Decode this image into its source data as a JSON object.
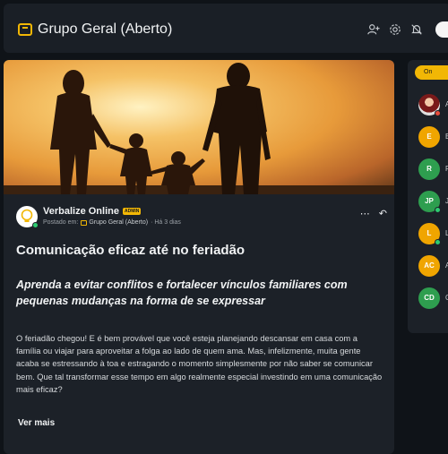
{
  "header": {
    "title": "Grupo Geral (Aberto)",
    "icons": [
      "add-member-icon",
      "settings-icon",
      "notifications-off-icon"
    ]
  },
  "post": {
    "author": {
      "name": "Verbalize Online",
      "badge": "ADMIN",
      "posted_in_label": "Postado em:",
      "group_link": "Grupo Geral (Aberto)",
      "time": "· Há 3 dias"
    },
    "title": "Comunicação eficaz até no feriadão",
    "subtitle": "Aprenda a evitar conflitos e fortalecer vínculos familiares com pequenas mudanças na forma de se expressar",
    "body": "O feriadão chegou! E é bem provável que você esteja planejando descansar em casa com a família ou viajar para aproveitar a folga ao lado de quem ama. Mas, infelizmente, muita gente acaba se estressando à toa e estragando o momento simplesmente por não saber se comunicar bem. Que tal transformar esse tempo em algo realmente especial investindo em uma comunicação mais eficaz?",
    "see_more": "Ver mais",
    "more_icon": "⋯",
    "share_icon": "↶"
  },
  "members_panel": {
    "tab_label": "On",
    "members": [
      {
        "initials": "",
        "name": "A",
        "color": "#c0392b",
        "status": "busy",
        "photo": true
      },
      {
        "initials": "E",
        "name": "E",
        "color": "#f0a500",
        "status": "none"
      },
      {
        "initials": "R",
        "name": "R",
        "color": "#2e9e4f",
        "status": "none"
      },
      {
        "initials": "JP",
        "name": "J",
        "color": "#2e9e4f",
        "status": "online"
      },
      {
        "initials": "L",
        "name": "L",
        "color": "#f0a500",
        "status": "online"
      },
      {
        "initials": "AC",
        "name": "A",
        "color": "#f0a500",
        "status": "none"
      },
      {
        "initials": "CD",
        "name": "C",
        "color": "#2e9e4f",
        "status": "none"
      }
    ]
  }
}
